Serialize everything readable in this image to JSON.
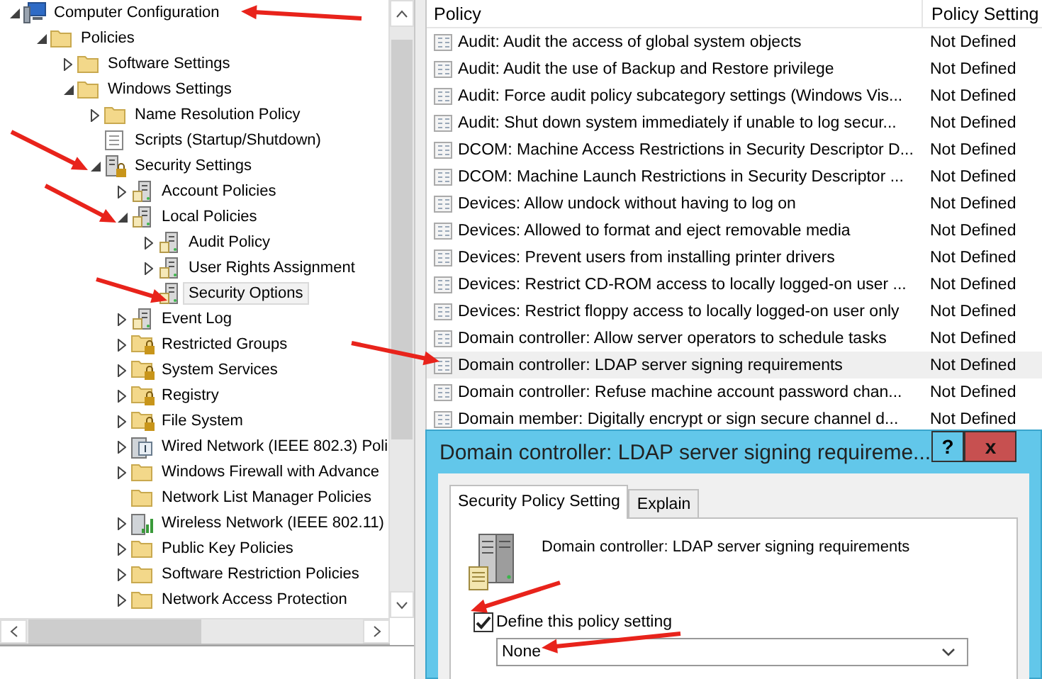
{
  "tree": [
    {
      "label": "Computer Configuration",
      "kind": "computer",
      "expanded": true,
      "selected": false,
      "children": [
        {
          "label": "Policies",
          "kind": "folder",
          "expanded": true,
          "selected": false,
          "children": [
            {
              "label": "Software Settings",
              "kind": "folder",
              "expanded": false,
              "selected": false
            },
            {
              "label": "Windows Settings",
              "kind": "folder",
              "expanded": true,
              "selected": false,
              "children": [
                {
                  "label": "Name Resolution Policy",
                  "kind": "folder",
                  "expanded": false,
                  "selected": false
                },
                {
                  "label": "Scripts (Startup/Shutdown)",
                  "kind": "script",
                  "selected": false
                },
                {
                  "label": "Security Settings",
                  "kind": "secured",
                  "expanded": true,
                  "selected": false,
                  "children": [
                    {
                      "label": "Account Policies",
                      "kind": "policy",
                      "expanded": false,
                      "selected": false
                    },
                    {
                      "label": "Local Policies",
                      "kind": "policy",
                      "expanded": true,
                      "selected": false,
                      "children": [
                        {
                          "label": "Audit Policy",
                          "kind": "policy",
                          "expanded": false,
                          "selected": false
                        },
                        {
                          "label": "User Rights Assignment",
                          "kind": "policy",
                          "expanded": false,
                          "selected": false
                        },
                        {
                          "label": "Security Options",
                          "kind": "policy",
                          "selected": true
                        }
                      ]
                    },
                    {
                      "label": "Event Log",
                      "kind": "policy",
                      "expanded": false,
                      "selected": false
                    },
                    {
                      "label": "Restricted Groups",
                      "kind": "locked",
                      "expanded": false,
                      "selected": false
                    },
                    {
                      "label": "System Services",
                      "kind": "locked",
                      "expanded": false,
                      "selected": false
                    },
                    {
                      "label": "Registry",
                      "kind": "locked",
                      "expanded": false,
                      "selected": false
                    },
                    {
                      "label": "File System",
                      "kind": "locked",
                      "expanded": false,
                      "selected": false
                    },
                    {
                      "label": "Wired Network (IEEE 802.3) Poli",
                      "kind": "wired",
                      "expanded": false,
                      "selected": false
                    },
                    {
                      "label": "Windows Firewall with Advance",
                      "kind": "folder",
                      "expanded": false,
                      "selected": false
                    },
                    {
                      "label": "Network List Manager Policies",
                      "kind": "folder",
                      "selected": false
                    },
                    {
                      "label": "Wireless Network (IEEE 802.11)",
                      "kind": "wireless",
                      "expanded": false,
                      "selected": false
                    },
                    {
                      "label": "Public Key Policies",
                      "kind": "folder",
                      "expanded": false,
                      "selected": false
                    },
                    {
                      "label": "Software Restriction Policies",
                      "kind": "folder",
                      "expanded": false,
                      "selected": false
                    },
                    {
                      "label": "Network Access Protection",
                      "kind": "folder",
                      "expanded": false,
                      "selected": false
                    }
                  ]
                }
              ]
            }
          ]
        }
      ]
    }
  ],
  "table": {
    "columns": [
      "Policy",
      "Policy Setting"
    ],
    "rows": [
      {
        "policy": "Audit: Audit the access of global system objects",
        "setting": "Not Defined",
        "selected": false
      },
      {
        "policy": "Audit: Audit the use of Backup and Restore privilege",
        "setting": "Not Defined",
        "selected": false
      },
      {
        "policy": "Audit: Force audit policy subcategory settings (Windows Vis...",
        "setting": "Not Defined",
        "selected": false
      },
      {
        "policy": "Audit: Shut down system immediately if unable to log secur...",
        "setting": "Not Defined",
        "selected": false
      },
      {
        "policy": "DCOM: Machine Access Restrictions in Security Descriptor D...",
        "setting": "Not Defined",
        "selected": false
      },
      {
        "policy": "DCOM: Machine Launch Restrictions in Security Descriptor ...",
        "setting": "Not Defined",
        "selected": false
      },
      {
        "policy": "Devices: Allow undock without having to log on",
        "setting": "Not Defined",
        "selected": false
      },
      {
        "policy": "Devices: Allowed to format and eject removable media",
        "setting": "Not Defined",
        "selected": false
      },
      {
        "policy": "Devices: Prevent users from installing printer drivers",
        "setting": "Not Defined",
        "selected": false
      },
      {
        "policy": "Devices: Restrict CD-ROM access to locally logged-on user ...",
        "setting": "Not Defined",
        "selected": false
      },
      {
        "policy": "Devices: Restrict floppy access to locally logged-on user only",
        "setting": "Not Defined",
        "selected": false
      },
      {
        "policy": "Domain controller: Allow server operators to schedule tasks",
        "setting": "Not Defined",
        "selected": false
      },
      {
        "policy": "Domain controller: LDAP server signing requirements",
        "setting": "Not Defined",
        "selected": true
      },
      {
        "policy": "Domain controller: Refuse machine account password chan...",
        "setting": "Not Defined",
        "selected": false
      },
      {
        "policy": "Domain member: Digitally encrypt or sign secure channel d...",
        "setting": "Not Defined",
        "selected": false
      }
    ]
  },
  "dialog": {
    "title": "Domain controller: LDAP server signing requireme...",
    "help": "?",
    "close": "x",
    "tabs": [
      {
        "label": "Security Policy Setting",
        "selected": true
      },
      {
        "label": "Explain",
        "selected": false
      }
    ],
    "policy_name": "Domain controller: LDAP server signing requirements",
    "define": {
      "label": "Define this policy setting",
      "checked": true
    },
    "dropdown": {
      "value": "None"
    }
  }
}
